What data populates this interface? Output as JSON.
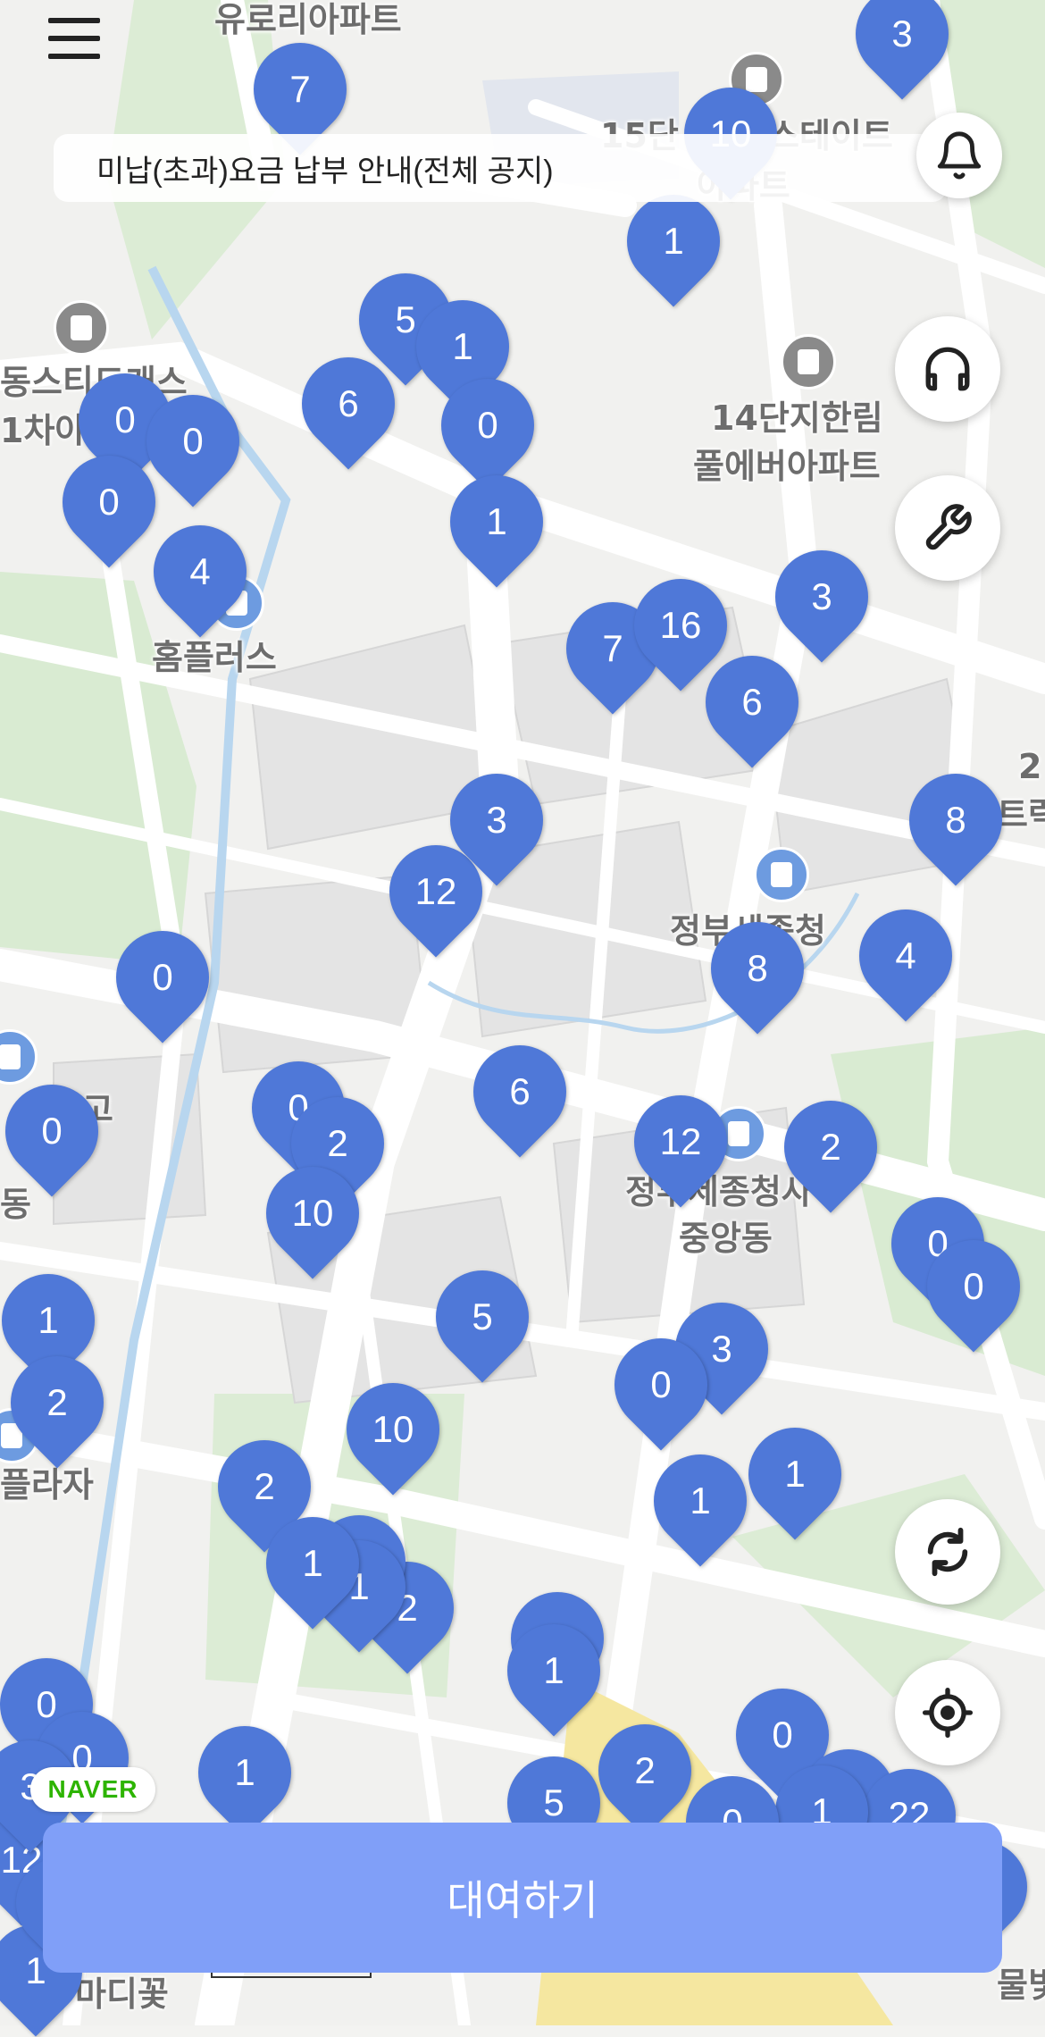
{
  "notice": {
    "text": "미납(초과)요금 납부 안내(전체 공지)"
  },
  "rent_button": {
    "label": "대여하기"
  },
  "naver_badge": {
    "text": "NAVER"
  },
  "buttons": {
    "menu": "hamburger-menu-icon",
    "notification": "bell-icon",
    "support": "headset-icon",
    "repair": "wrench-icon",
    "refresh": "refresh-icon",
    "location": "gps-locate-icon"
  },
  "map_labels": [
    {
      "id": "label-euroa",
      "text": "유로리아파트"
    },
    {
      "id": "label-15danji-1",
      "text": "15단"
    },
    {
      "id": "label-15danji-2",
      "text": "스테이트"
    },
    {
      "id": "label-15danji-3",
      "text": "아파트"
    },
    {
      "id": "label-dongseuti-1",
      "text": "동스티드캐스"
    },
    {
      "id": "label-dongseuti-2",
      "text": "1차아"
    },
    {
      "id": "label-14danji-1",
      "text": "14단지한림"
    },
    {
      "id": "label-14danji-2",
      "text": "풀에버아파트"
    },
    {
      "id": "label-homeplus",
      "text": "홈플러스"
    },
    {
      "id": "label-sejong-office",
      "text": "정부세종청"
    },
    {
      "id": "label-sejong-jungang-1",
      "text": "정부세종청사"
    },
    {
      "id": "label-sejong-jungang-2",
      "text": "중앙동"
    },
    {
      "id": "label-dong-left",
      "text": "동"
    },
    {
      "id": "label-go",
      "text": "고"
    },
    {
      "id": "label-plaza",
      "text": "플라자"
    },
    {
      "id": "label-madikkot",
      "text": "마디꽃"
    },
    {
      "id": "label-mulbit",
      "text": "물빛"
    },
    {
      "id": "label-right-2",
      "text": "2"
    },
    {
      "id": "label-right-teu",
      "text": "트럭"
    }
  ],
  "markers": [
    "3",
    "7",
    "10",
    "1",
    "5",
    "1",
    "6",
    "0",
    "0",
    "0",
    "0",
    "1",
    "4",
    "7",
    "16",
    "3",
    "6",
    "8",
    "12",
    "3",
    "0",
    "8",
    "4",
    "0",
    "6",
    "12",
    "0",
    "2",
    "2",
    "10",
    "0",
    "0",
    "5",
    "1",
    "2",
    "2",
    "3",
    "1",
    "1",
    "2",
    "1",
    "2",
    "1",
    "0",
    "0",
    "5",
    "2",
    "0",
    "0",
    "22",
    "12",
    "1",
    "1",
    "6",
    "3",
    "1",
    "0",
    "1",
    "10",
    "1",
    "0",
    "0",
    "6"
  ],
  "colors": {
    "marker": "#4f78d8",
    "rent_button": "#809ff8",
    "naver_green": "#2db400"
  }
}
